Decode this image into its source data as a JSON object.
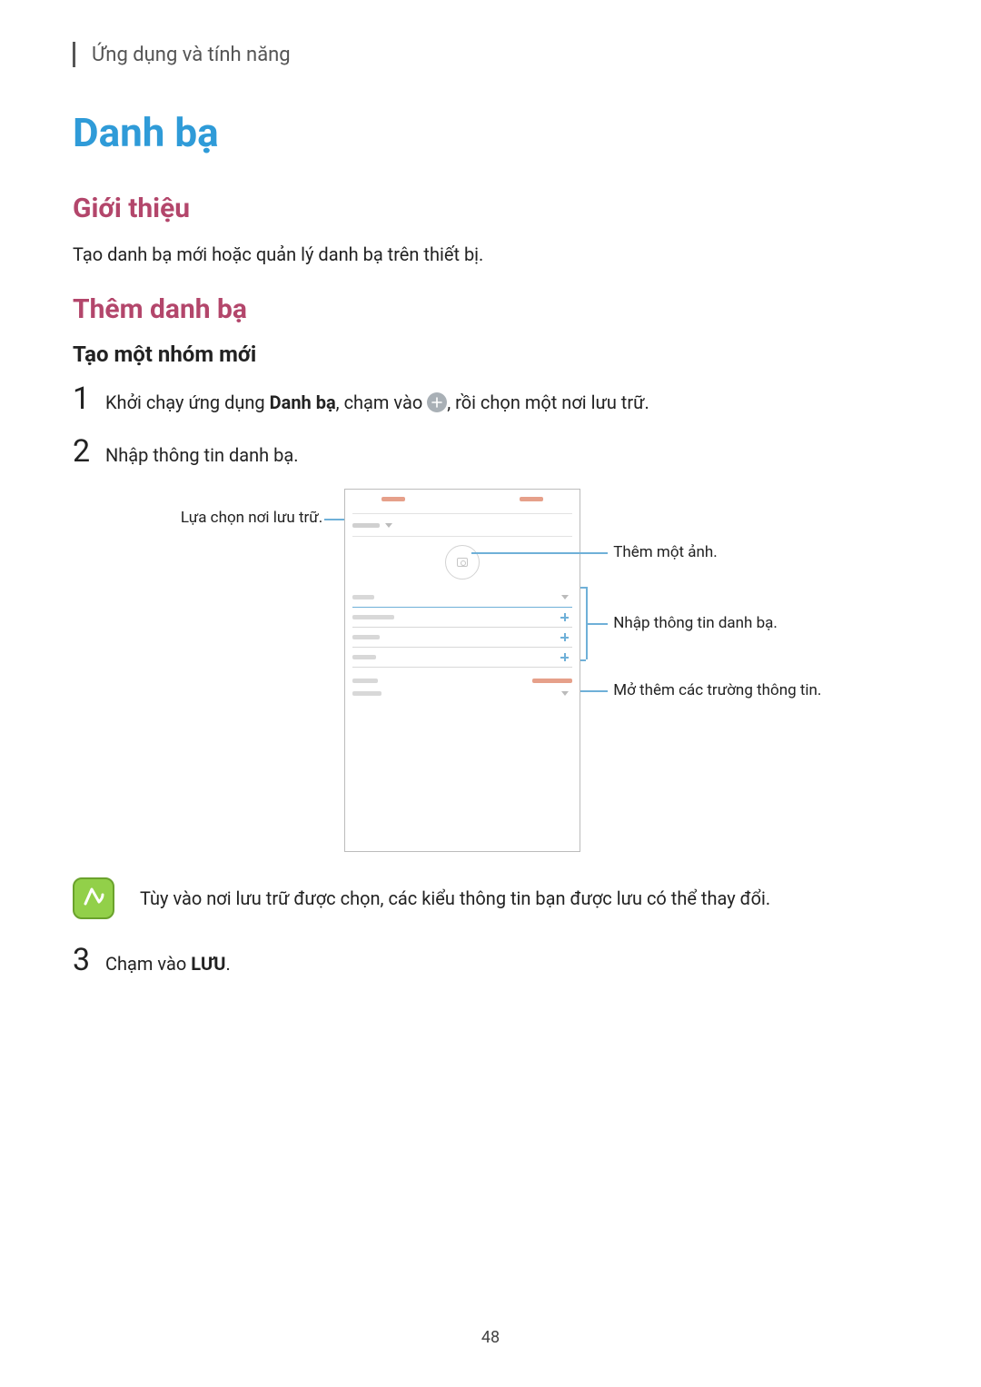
{
  "breadcrumb": "Ứng dụng và tính năng",
  "h1": "Danh bạ",
  "intro": {
    "heading": "Giới thiệu",
    "body": "Tạo danh bạ mới hoặc quản lý danh bạ trên thiết bị."
  },
  "add": {
    "heading": "Thêm danh bạ",
    "sub": "Tạo một nhóm mới"
  },
  "steps": {
    "s1_a": "Khởi chạy ứng dụng ",
    "s1_bold": "Danh bạ",
    "s1_b": ", chạm vào ",
    "s1_c": ", rồi chọn một nơi lưu trữ.",
    "s2": "Nhập thông tin danh bạ.",
    "s3_a": "Chạm vào ",
    "s3_bold": "LƯU",
    "s3_b": "."
  },
  "callouts": {
    "left": "Lựa chọn nơi lưu trữ.",
    "r1": "Thêm một ảnh.",
    "r2": "Nhập thông tin danh bạ.",
    "r3": "Mở thêm các trường thông tin."
  },
  "note": "Tùy vào nơi lưu trữ được chọn, các kiểu thông tin bạn được lưu có thể thay đổi.",
  "page_number": "48"
}
